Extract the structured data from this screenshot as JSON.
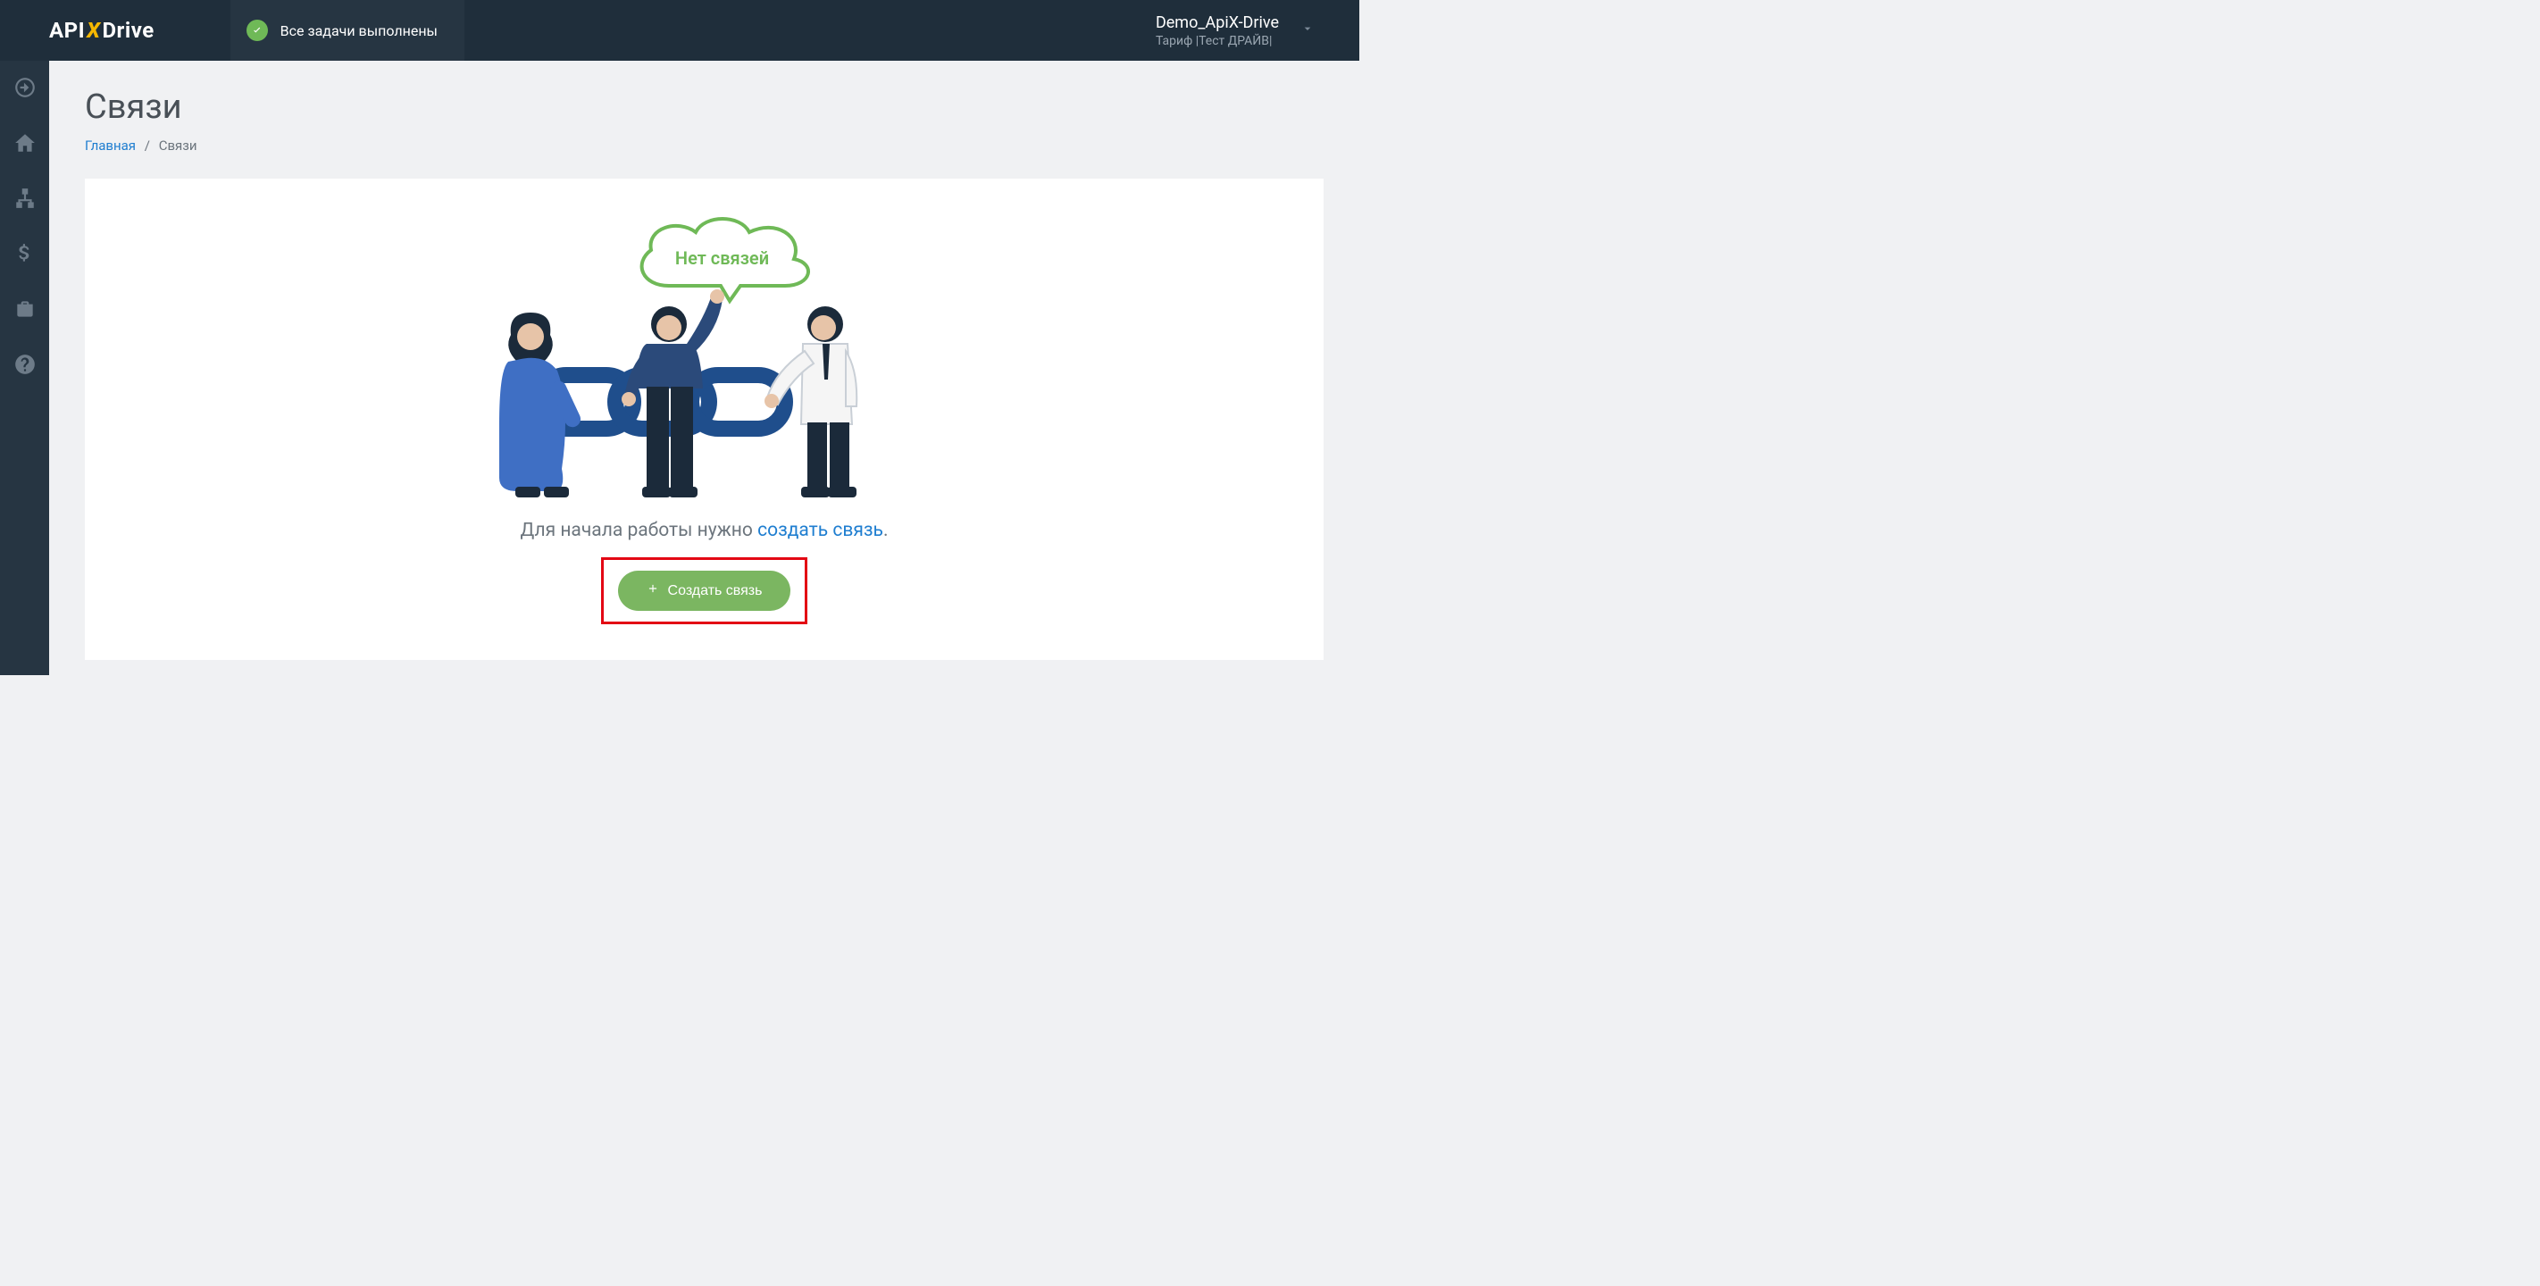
{
  "header": {
    "logo_api": "API",
    "logo_x": "X",
    "logo_drive": "Drive",
    "status_text": "Все задачи выполнены"
  },
  "account": {
    "name": "Demo_ApiX-Drive",
    "plan": "Тариф |Тест ДРАЙВ|"
  },
  "sidebar": {
    "items": [
      {
        "name": "start-icon"
      },
      {
        "name": "home-icon"
      },
      {
        "name": "connections-icon"
      },
      {
        "name": "billing-icon"
      },
      {
        "name": "briefcase-icon"
      },
      {
        "name": "help-icon"
      }
    ]
  },
  "page": {
    "title": "Связи",
    "breadcrumb_home": "Главная",
    "breadcrumb_current": "Связи"
  },
  "empty_state": {
    "cloud_text": "Нет связей",
    "prompt_prefix": "Для начала работы нужно ",
    "prompt_link": "создать связь",
    "prompt_suffix": ".",
    "button_label": "Создать связь"
  }
}
